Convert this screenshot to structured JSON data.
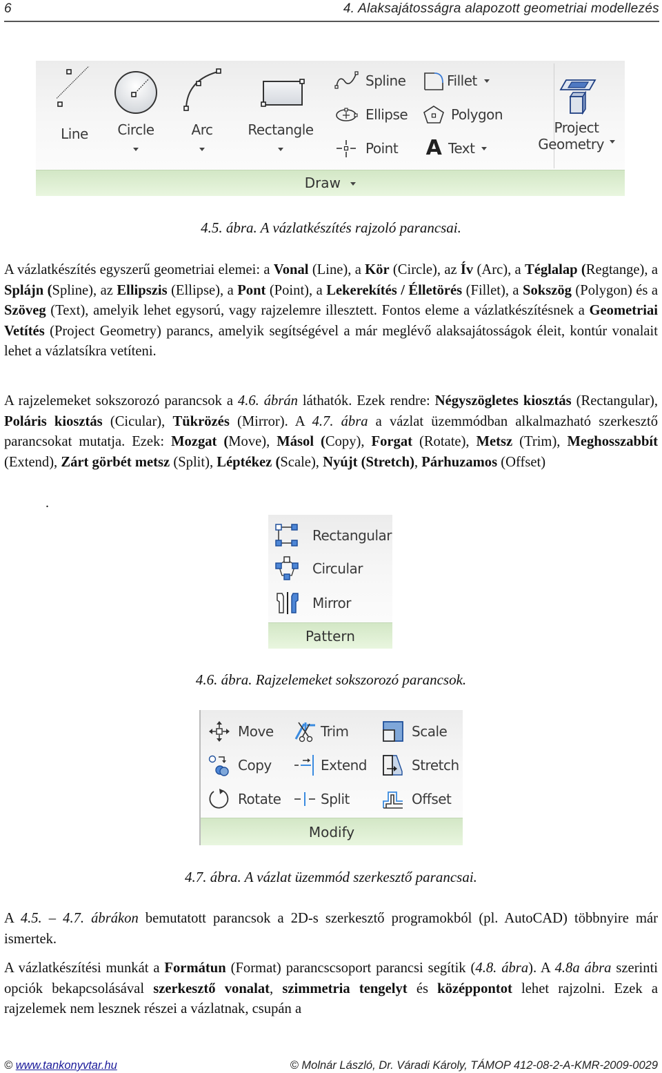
{
  "header": {
    "page_number": "6",
    "chapter_title": "4. Alaksajátosságra alapozott geometriai modellezés"
  },
  "figure_4_5": {
    "panel_title": "Draw",
    "big_buttons": [
      {
        "label": "Line",
        "icon": "line-icon",
        "has_dropdown": false
      },
      {
        "label": "Circle",
        "icon": "circle-icon",
        "has_dropdown": true
      },
      {
        "label": "Arc",
        "icon": "arc-icon",
        "has_dropdown": true
      },
      {
        "label": "Rectangle",
        "icon": "rectangle-icon",
        "has_dropdown": true
      }
    ],
    "small_buttons": [
      {
        "label": "Spline",
        "icon": "spline-icon"
      },
      {
        "label": "Fillet",
        "icon": "fillet-icon",
        "has_dropdown": true
      },
      {
        "label": "Ellipse",
        "icon": "ellipse-icon"
      },
      {
        "label": "Polygon",
        "icon": "polygon-icon"
      },
      {
        "label": "Point",
        "icon": "point-icon"
      },
      {
        "label": "Text",
        "icon": "text-icon",
        "has_dropdown": true
      }
    ],
    "project_geometry": {
      "line1": "Project",
      "line2": "Geometry",
      "icon": "project-geometry-icon"
    },
    "caption": "4.5. ábra. A vázlatkészítés rajzoló parancsai."
  },
  "paragraph1": {
    "t1": "A vázlatkészítés egyszerű geometriai elemei: a ",
    "b1": "Vonal",
    "t2": " (Line), a ",
    "b2": "Kör",
    "t3": " (Circle), az ",
    "b3": "Ív",
    "t4": " (Arc), a ",
    "b4": "Téglalap (",
    "t5": "Regtange), a ",
    "b5": "Splájn (",
    "t6": "Spline), az ",
    "b6": "Ellipszis",
    "t7": " (Ellipse), a ",
    "b7": "Pont",
    "t8": " (Point), a ",
    "b8": "Lekerekítés / Élletörés",
    "t9": " (Fillet), a ",
    "b9": "Sokszög",
    "t10": " (Polygon) és a ",
    "b10": "Szöveg",
    "t11": " (Text), amelyik lehet egysorú, vagy rajzelemre illesztett. Fontos eleme a vázlatkészítésnek a ",
    "b11": "Geometriai Vetítés",
    "t12": " (Project Geometry) parancs, amelyik segítségével a már meglévő alaksajátosságok éleit, kontúr vonalait lehet a vázlatsíkra vetíteni."
  },
  "paragraph2": {
    "t1": "A rajzelemeket sokszorozó parancsok a ",
    "i1": "4.6. ábrán",
    "t2": " láthatók. Ezek rendre: ",
    "b1": "Négyszögletes kiosztás",
    "t3": " (Rectangular), ",
    "b2": "Poláris kiosztás",
    "t4": " (Cicular), ",
    "b3": "Tükrözés",
    "t5": " (Mirror). A ",
    "i2": "4.7. ábra",
    "t6": " a vázlat üzemmódban alkalmazható szerkesztő parancsokat mutatja. Ezek: ",
    "b4": "Mozgat (",
    "t7": "Move), ",
    "b5": "Másol (",
    "t8": "Copy), ",
    "b6": "Forgat",
    "t9": " (Rotate), ",
    "b7": "Metsz",
    "t10": " (Trim), ",
    "b8": "Meghosszabbít",
    "t11": " (Extend), ",
    "b9": "Zárt görbét metsz",
    "t12": " (Split), ",
    "b10": "Léptékez (",
    "t13": "Scale), ",
    "b11": "Nyújt (Stretch)",
    "t14": ", ",
    "b12": "Párhuzamos",
    "t15": " (Offset)",
    "stray_dot": "."
  },
  "figure_4_6": {
    "panel_title": "Pattern",
    "buttons": [
      {
        "label": "Rectangular",
        "icon": "rectangular-pattern-icon"
      },
      {
        "label": "Circular",
        "icon": "circular-pattern-icon"
      },
      {
        "label": "Mirror",
        "icon": "mirror-icon"
      }
    ],
    "caption": "4.6. ábra. Rajzelemeket sokszorozó parancsok."
  },
  "figure_4_7": {
    "panel_title": "Modify",
    "buttons": [
      {
        "label": "Move",
        "icon": "move-icon"
      },
      {
        "label": "Trim",
        "icon": "trim-icon"
      },
      {
        "label": "Scale",
        "icon": "scale-icon"
      },
      {
        "label": "Copy",
        "icon": "copy-icon"
      },
      {
        "label": "Extend",
        "icon": "extend-icon"
      },
      {
        "label": "Stretch",
        "icon": "stretch-icon"
      },
      {
        "label": "Rotate",
        "icon": "rotate-icon"
      },
      {
        "label": "Split",
        "icon": "split-icon"
      },
      {
        "label": "Offset",
        "icon": "offset-icon"
      }
    ],
    "caption": "4.7. ábra. A vázlat üzemmód szerkesztő parancsai."
  },
  "paragraph3": {
    "t1": "A ",
    "i1": "4.5. – 4.7. ábrákon",
    "t2": " bemutatott parancsok a 2D-s szerkesztő programokból (pl. AutoCAD) többnyire már ismertek."
  },
  "paragraph4": {
    "t1": "A vázlatkészítési munkát a ",
    "b1": "Formátun",
    "t2": " (Format) parancscsoport parancsi segítik (",
    "i1": "4.8. ábra",
    "t3": "). A ",
    "i2": "4.8a ábra",
    "t4": " szerinti opciók bekapcsolásával ",
    "b2": "szerkesztő vonalat",
    "t5": ", ",
    "b3": "szimmetria tengelyt",
    "t6": " és ",
    "b4": "középpontot",
    "t7": " lehet rajzolni. Ezek a rajzelemek nem lesznek részei a vázlatnak, csupán a"
  },
  "footer": {
    "left_copyright": "©",
    "left_link": "www.tankonyvtar.hu",
    "right_text": "© Molnár László, Dr. Váradi Károly, TÁMOP 412-08-2-A-KMR-2009-0029"
  }
}
